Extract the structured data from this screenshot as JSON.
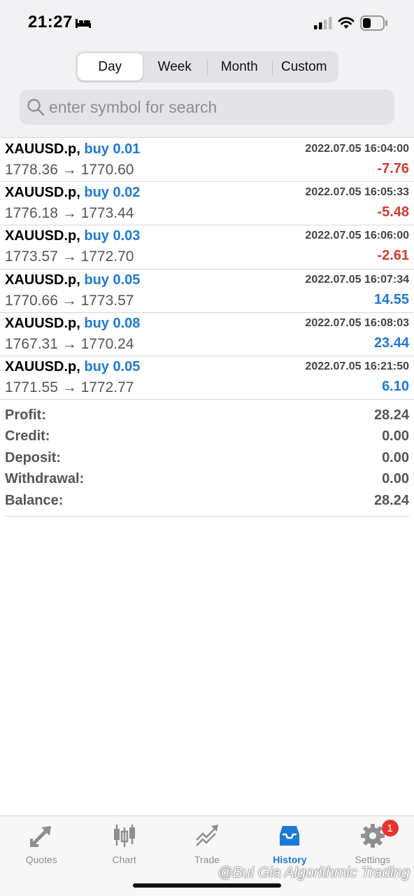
{
  "status_bar": {
    "time": "21:27"
  },
  "tabs": [
    "Day",
    "Week",
    "Month",
    "Custom"
  ],
  "active_tab_index": 0,
  "search": {
    "placeholder": "enter symbol for search"
  },
  "trades": [
    {
      "symbol": "XAUUSD.p,",
      "side": "buy 0.01",
      "datetime": "2022.07.05 16:04:00",
      "prices": "1778.36 → 1770.60",
      "profit": "-7.76",
      "profit_sign": "neg"
    },
    {
      "symbol": "XAUUSD.p,",
      "side": "buy 0.02",
      "datetime": "2022.07.05 16:05:33",
      "prices": "1776.18 → 1773.44",
      "profit": "-5.48",
      "profit_sign": "neg"
    },
    {
      "symbol": "XAUUSD.p,",
      "side": "buy 0.03",
      "datetime": "2022.07.05 16:06:00",
      "prices": "1773.57 → 1772.70",
      "profit": "-2.61",
      "profit_sign": "neg"
    },
    {
      "symbol": "XAUUSD.p,",
      "side": "buy 0.05",
      "datetime": "2022.07.05 16:07:34",
      "prices": "1770.66 → 1773.57",
      "profit": "14.55",
      "profit_sign": "pos"
    },
    {
      "symbol": "XAUUSD.p,",
      "side": "buy 0.08",
      "datetime": "2022.07.05 16:08:03",
      "prices": "1767.31 → 1770.24",
      "profit": "23.44",
      "profit_sign": "pos"
    },
    {
      "symbol": "XAUUSD.p,",
      "side": "buy 0.05",
      "datetime": "2022.07.05 16:21:50",
      "prices": "1771.55 → 1772.77",
      "profit": "6.10",
      "profit_sign": "pos"
    }
  ],
  "summary": {
    "profit_label": "Profit:",
    "profit_value": "28.24",
    "credit_label": "Credit:",
    "credit_value": "0.00",
    "deposit_label": "Deposit:",
    "deposit_value": "0.00",
    "withdrawal_label": "Withdrawal:",
    "withdrawal_value": "0.00",
    "balance_label": "Balance:",
    "balance_value": "28.24"
  },
  "tabbar": {
    "quotes": "Quotes",
    "chart": "Chart",
    "trade": "Trade",
    "history": "History",
    "settings": "Settings",
    "settings_badge": "1",
    "active": "history"
  },
  "watermark": "@Bui Gia Algorithmic Trading",
  "colors": {
    "accent": "#1d79d6",
    "loss": "#d33b2c",
    "badge": "#e8342f"
  }
}
